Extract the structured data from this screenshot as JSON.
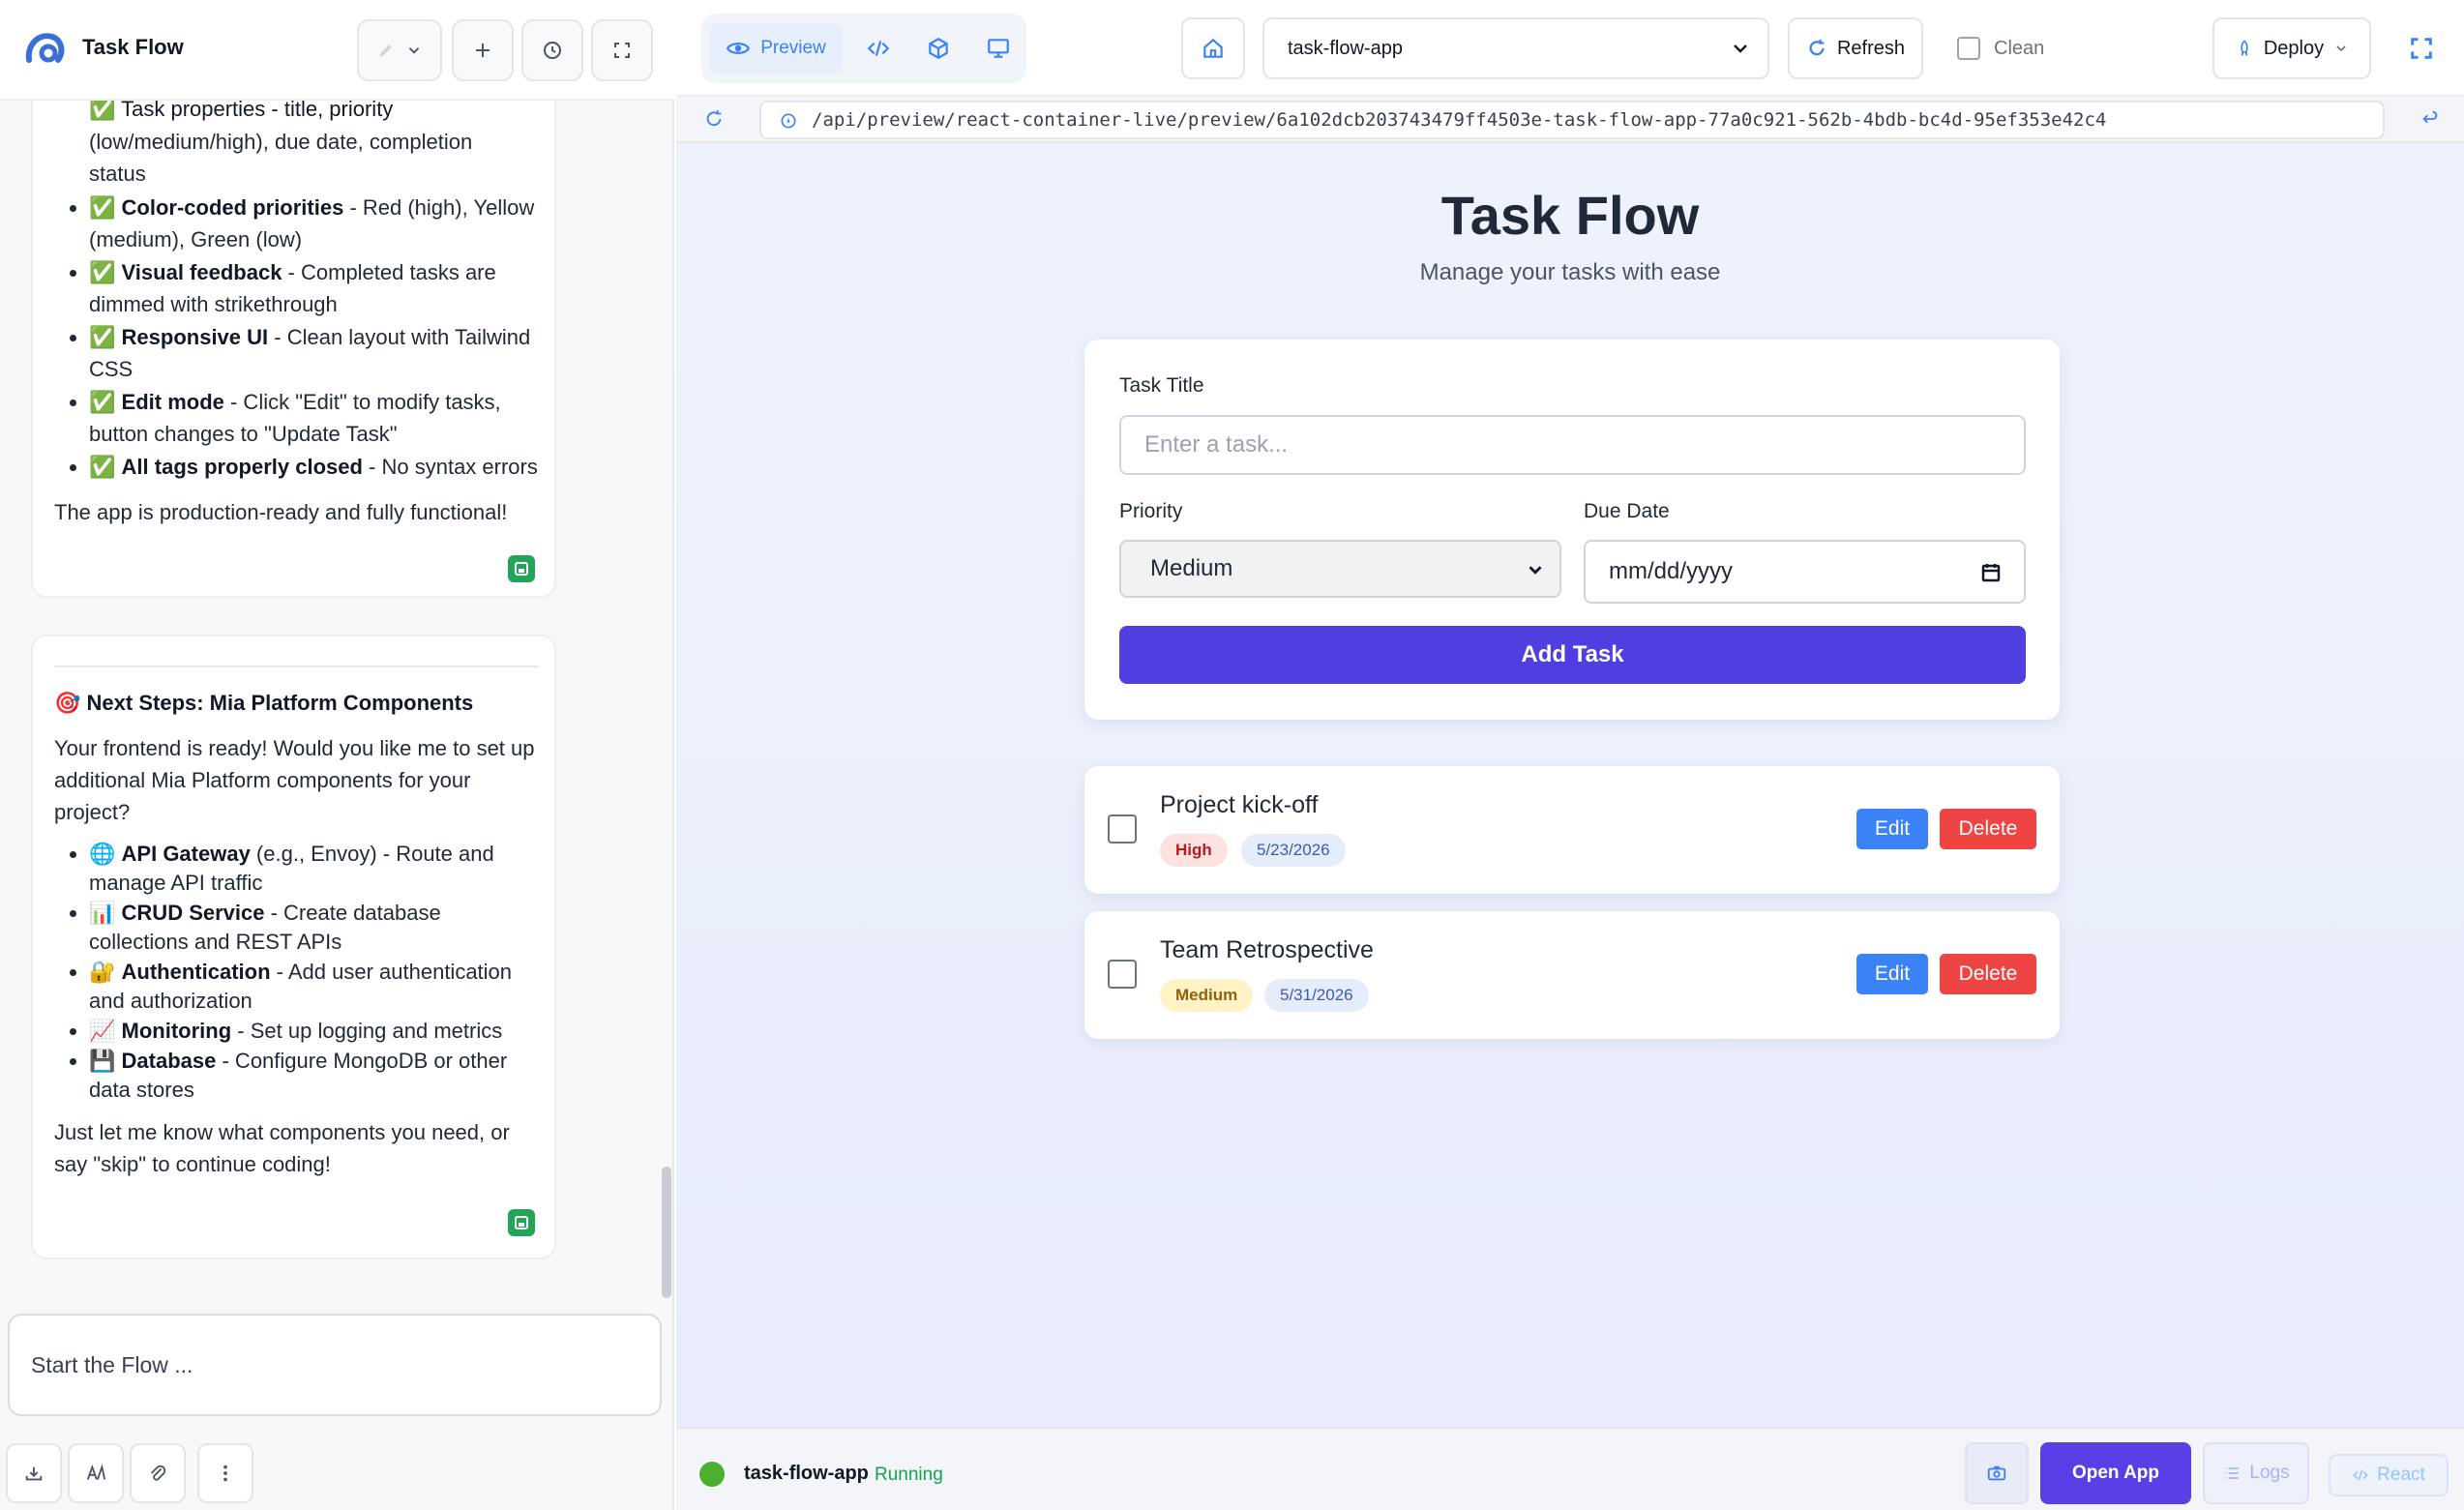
{
  "app": {
    "title": "Task Flow"
  },
  "chat": {
    "card1": {
      "partial_line": "✅ Task properties - title, priority (low/medium/high), due date, completion status",
      "partial_a": "(low/medium/high), due date, completion",
      "partial_b": "status",
      "items": [
        {
          "bold": "Color-coded priorities",
          "text": " - Red (high), Yellow (medium), Green (low)"
        },
        {
          "bold": "Visual feedback",
          "text": " - Completed tasks are dimmed with strikethrough"
        },
        {
          "bold": "Responsive UI",
          "text": " - Clean layout with Tailwind CSS"
        },
        {
          "bold": "Edit mode",
          "text": " - Click \"Edit\" to modify tasks, button changes to \"Update Task\""
        },
        {
          "bold": "All tags properly closed",
          "text": " - No syntax errors"
        }
      ],
      "check": "✅",
      "footer": "The app is production-ready and fully functional!"
    },
    "card2": {
      "heading_icon": "🎯",
      "heading": "Next Steps: Mia Platform Components",
      "intro": "Your frontend is ready! Would you like me to set up additional Mia Platform components for your project?",
      "items": [
        {
          "icon": "🌐",
          "bold": "API Gateway",
          "text": " (e.g., Envoy) - Route and manage API traffic"
        },
        {
          "icon": "📊",
          "bold": "CRUD Service",
          "text": " - Create database collections and REST APIs"
        },
        {
          "icon": "🔐",
          "bold": "Authentication",
          "text": " - Add user authentication and authorization"
        },
        {
          "icon": "📈",
          "bold": "Monitoring",
          "text": " - Set up logging and metrics"
        },
        {
          "icon": "💾",
          "bold": "Database",
          "text": " - Configure MongoDB or other data stores"
        }
      ],
      "outro": "Just let me know what components you need, or say \"skip\" to continue coding!"
    },
    "composer_placeholder": "Start the Flow ..."
  },
  "topbar": {
    "preview_label": "Preview",
    "app_selected": "task-flow-app",
    "refresh_label": "Refresh",
    "clean_label": "Clean",
    "deploy_label": "Deploy"
  },
  "url": "/api/preview/react-container-live/preview/6a102dcb203743479ff4503e-task-flow-app-77a0c921-562b-4bdb-bc4d-95ef353e42c4",
  "preview": {
    "title": "Task Flow",
    "subtitle": "Manage your tasks with ease",
    "form": {
      "task_title_label": "Task Title",
      "task_title_placeholder": "Enter a task...",
      "priority_label": "Priority",
      "priority_value": "Medium",
      "due_date_label": "Due Date",
      "due_date_placeholder": "mm/dd/yyyy",
      "add_button": "Add Task"
    },
    "tasks": [
      {
        "title": "Project kick-off",
        "priority": "High",
        "date": "5/23/2026",
        "edit": "Edit",
        "delete": "Delete"
      },
      {
        "title": "Team Retrospective",
        "priority": "Medium",
        "date": "5/31/2026",
        "edit": "Edit",
        "delete": "Delete"
      }
    ]
  },
  "statusbar": {
    "app_name": "task-flow-app",
    "status": "Running",
    "open_app": "Open App",
    "logs": "Logs",
    "react": "React"
  },
  "colors": {
    "accent": "#4f3fe0",
    "edit": "#3b82f6",
    "delete": "#ef4444",
    "running": "#16a34a",
    "high_badge_bg": "#fde2e2",
    "medium_badge_bg": "#fdf3c4"
  }
}
